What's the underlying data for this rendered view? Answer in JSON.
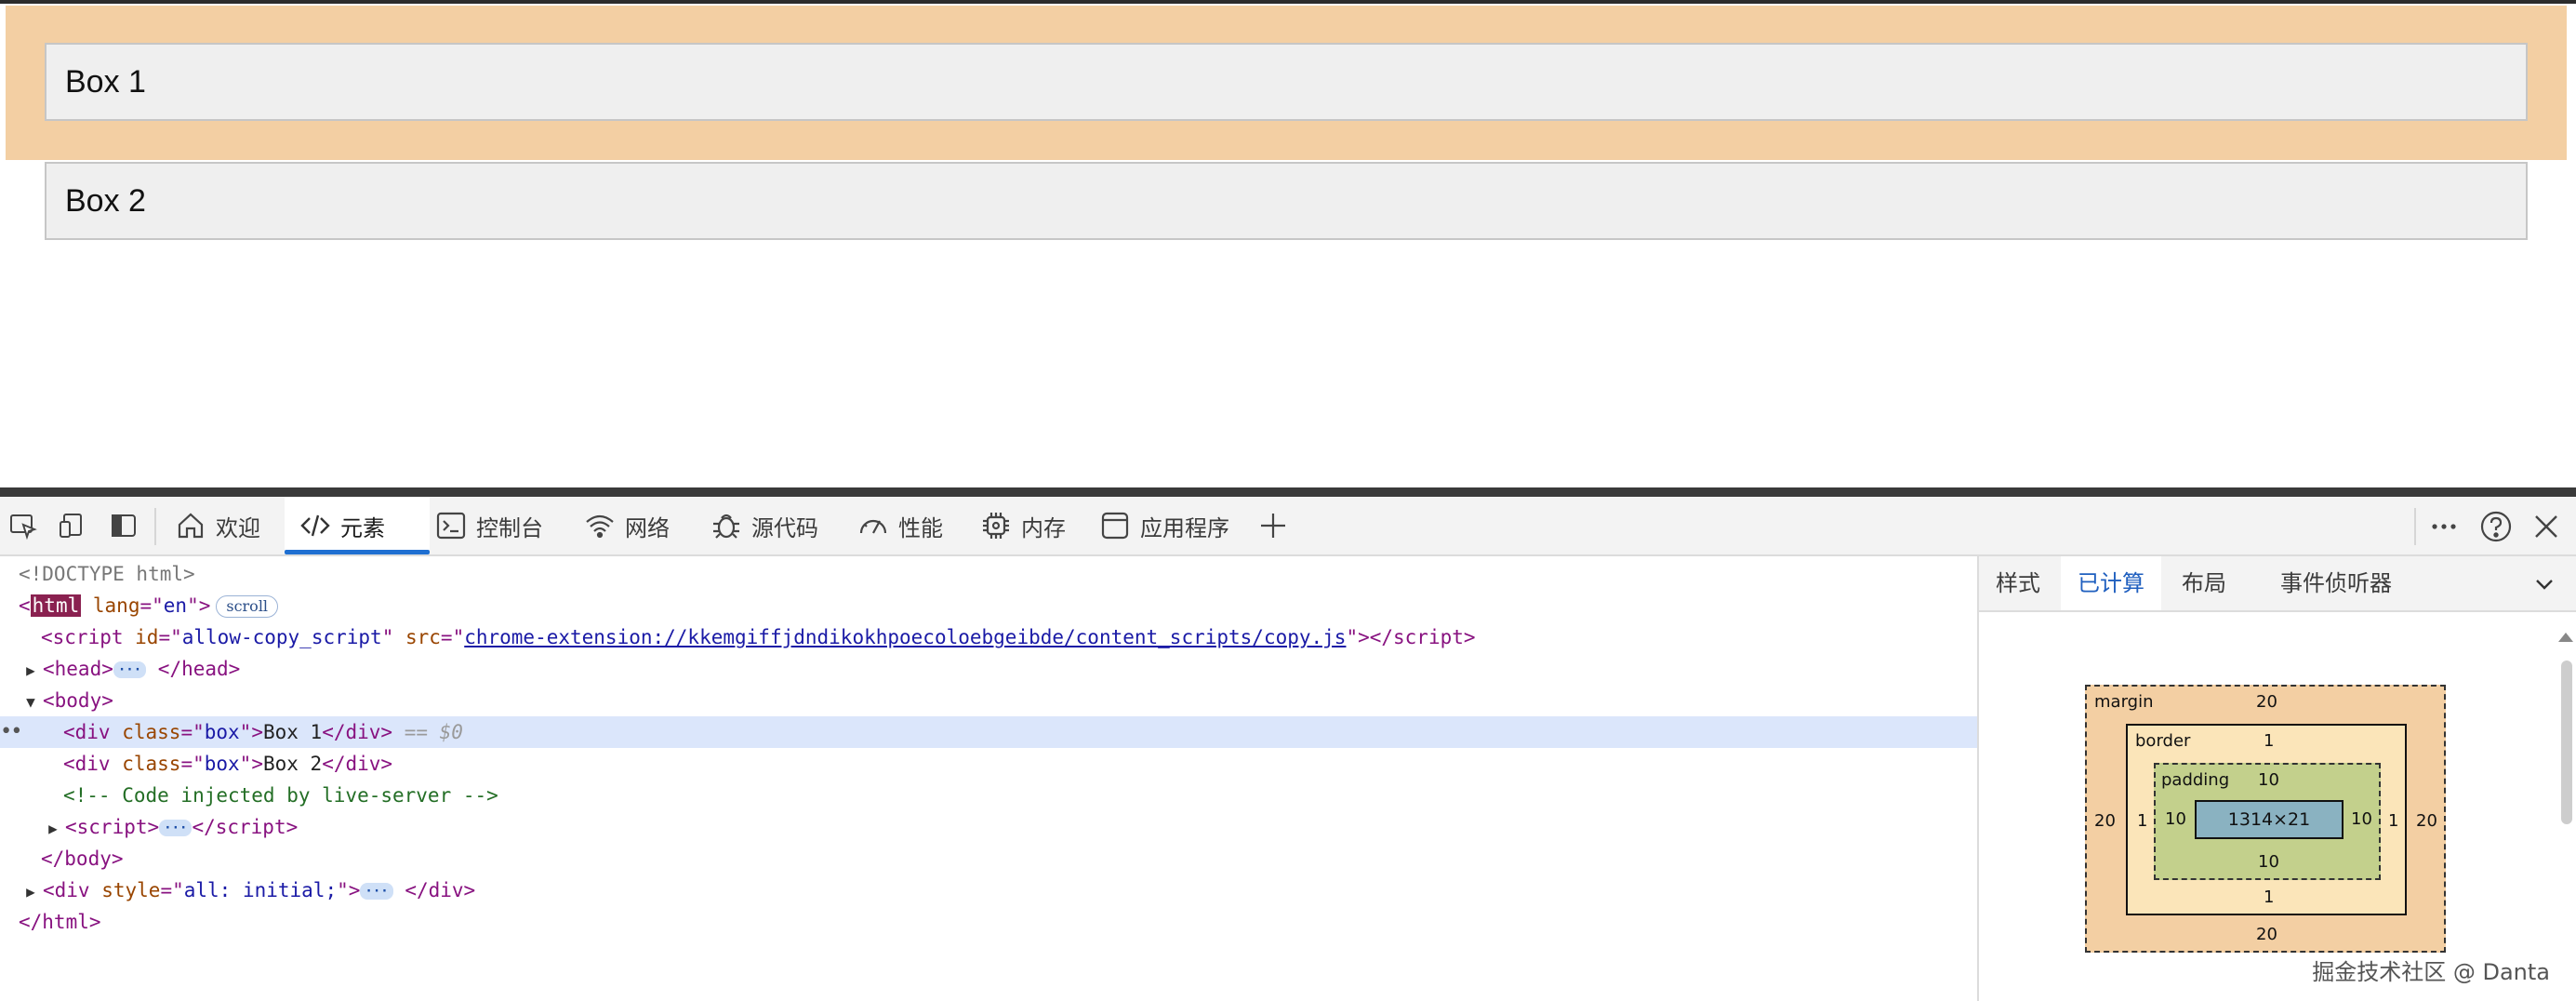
{
  "page": {
    "box1": "Box 1",
    "box2": "Box 2"
  },
  "devtools": {
    "tabs": [
      {
        "label": "欢迎",
        "icon": "home-icon"
      },
      {
        "label": "元素",
        "icon": "code-icon",
        "active": true
      },
      {
        "label": "控制台",
        "icon": "console-icon"
      },
      {
        "label": "网络",
        "icon": "wifi-icon"
      },
      {
        "label": "源代码",
        "icon": "bug-icon"
      },
      {
        "label": "性能",
        "icon": "gauge-icon"
      },
      {
        "label": "内存",
        "icon": "chip-icon"
      },
      {
        "label": "应用程序",
        "icon": "window-icon"
      }
    ],
    "add_tab_label": "+",
    "elements": {
      "doctype": "<!DOCTYPE html>",
      "html_tag": "html",
      "html_attr_name": "lang",
      "html_attr_value": "en",
      "scroll_badge": "scroll",
      "script_id_value": "allow-copy_script",
      "script_src_value": "chrome-extension://kkemgiffjdndikokhpoecoloebgeibde/content_scripts/copy.js",
      "div_class_value": "box",
      "box1_text": "Box 1",
      "box2_text": "Box 2",
      "selected_marker": "== $0",
      "comment": "<!-- Code injected by live-server -->",
      "div_style_value": "all: initial;",
      "ellipsis": "···"
    },
    "side": {
      "subtabs": [
        "样式",
        "已计算",
        "布局",
        "事件侦听器"
      ],
      "active_subtab": "已计算",
      "box_model": {
        "margin_label": "margin",
        "margin_top": "20",
        "margin_right": "20",
        "margin_bottom": "20",
        "margin_left": "20",
        "border_label": "border",
        "border_top": "1",
        "border_right": "1",
        "border_bottom": "1",
        "border_left": "1",
        "padding_label": "padding",
        "padding_top": "10",
        "padding_right": "10",
        "padding_bottom": "10",
        "padding_left": "10",
        "content": "1314×21"
      }
    },
    "watermark": "掘金技术社区 @ Danta"
  }
}
